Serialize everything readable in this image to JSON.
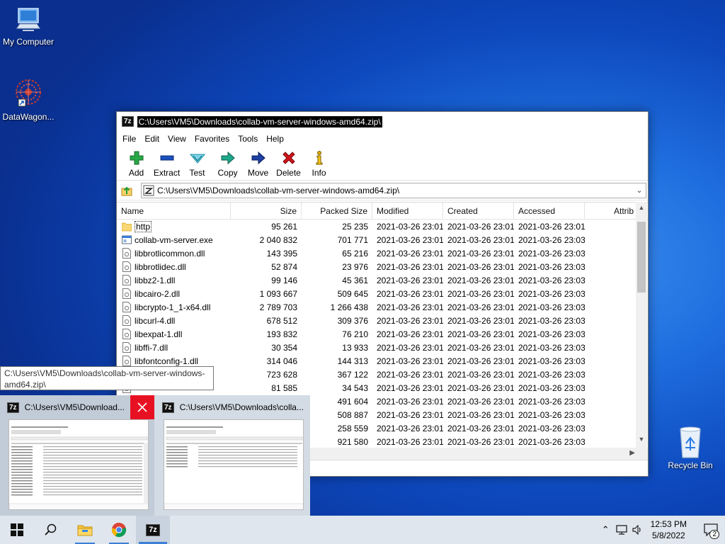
{
  "desktop": {
    "icons": [
      {
        "label": "My Computer",
        "icon": "computer-icon"
      },
      {
        "label": "DataWagon...",
        "icon": "datawagon-icon"
      },
      {
        "label": "Recycle Bin",
        "icon": "recycle-bin-icon"
      }
    ]
  },
  "window": {
    "title": "C:\\Users\\VM5\\Downloads\\collab-vm-server-windows-amd64.zip\\",
    "app_icon_text": "7z",
    "menu": [
      "File",
      "Edit",
      "View",
      "Favorites",
      "Tools",
      "Help"
    ],
    "toolbar": [
      {
        "label": "Add",
        "icon": "plus-icon",
        "color": "#28a745"
      },
      {
        "label": "Extract",
        "icon": "minus-icon",
        "color": "#1b4fbf"
      },
      {
        "label": "Test",
        "icon": "test-check-icon",
        "color": "#2ab3c9"
      },
      {
        "label": "Copy",
        "icon": "copy-arrow-icon",
        "color": "#1ba88a"
      },
      {
        "label": "Move",
        "icon": "move-arrow-icon",
        "color": "#1d3fa3"
      },
      {
        "label": "Delete",
        "icon": "delete-x-icon",
        "color": "#d0141b"
      },
      {
        "label": "Info",
        "icon": "info-icon",
        "color": "#e0a800"
      }
    ],
    "address": "C:\\Users\\VM5\\Downloads\\collab-vm-server-windows-amd64.zip\\",
    "columns": [
      "Name",
      "Size",
      "Packed Size",
      "Modified",
      "Created",
      "Accessed",
      "Attrib"
    ],
    "files": [
      {
        "name": "http",
        "type": "folder",
        "size": "95 261",
        "packed": "25 235",
        "modified": "2021-03-26 23:01",
        "created": "2021-03-26 23:01",
        "accessed": "2021-03-26 23:01"
      },
      {
        "name": "collab-vm-server.exe",
        "type": "exe",
        "size": "2 040 832",
        "packed": "701 771",
        "modified": "2021-03-26 23:01",
        "created": "2021-03-26 23:01",
        "accessed": "2021-03-26 23:03"
      },
      {
        "name": "libbrotlicommon.dll",
        "type": "dll",
        "size": "143 395",
        "packed": "65 216",
        "modified": "2021-03-26 23:01",
        "created": "2021-03-26 23:01",
        "accessed": "2021-03-26 23:03"
      },
      {
        "name": "libbrotlidec.dll",
        "type": "dll",
        "size": "52 874",
        "packed": "23 976",
        "modified": "2021-03-26 23:01",
        "created": "2021-03-26 23:01",
        "accessed": "2021-03-26 23:03"
      },
      {
        "name": "libbz2-1.dll",
        "type": "dll",
        "size": "99 146",
        "packed": "45 361",
        "modified": "2021-03-26 23:01",
        "created": "2021-03-26 23:01",
        "accessed": "2021-03-26 23:03"
      },
      {
        "name": "libcairo-2.dll",
        "type": "dll",
        "size": "1 093 667",
        "packed": "509 645",
        "modified": "2021-03-26 23:01",
        "created": "2021-03-26 23:01",
        "accessed": "2021-03-26 23:03"
      },
      {
        "name": "libcrypto-1_1-x64.dll",
        "type": "dll",
        "size": "2 789 703",
        "packed": "1 266 438",
        "modified": "2021-03-26 23:01",
        "created": "2021-03-26 23:01",
        "accessed": "2021-03-26 23:03"
      },
      {
        "name": "libcurl-4.dll",
        "type": "dll",
        "size": "678 512",
        "packed": "309 376",
        "modified": "2021-03-26 23:01",
        "created": "2021-03-26 23:01",
        "accessed": "2021-03-26 23:03"
      },
      {
        "name": "libexpat-1.dll",
        "type": "dll",
        "size": "193 832",
        "packed": "76 210",
        "modified": "2021-03-26 23:01",
        "created": "2021-03-26 23:01",
        "accessed": "2021-03-26 23:03"
      },
      {
        "name": "libffi-7.dll",
        "type": "dll",
        "size": "30 354",
        "packed": "13 933",
        "modified": "2021-03-26 23:01",
        "created": "2021-03-26 23:01",
        "accessed": "2021-03-26 23:03"
      },
      {
        "name": "libfontconfig-1.dll",
        "type": "dll",
        "size": "314 046",
        "packed": "144 313",
        "modified": "2021-03-26 23:01",
        "created": "2021-03-26 23:01",
        "accessed": "2021-03-26 23:03"
      },
      {
        "name": "",
        "type": "dll",
        "size": "723 628",
        "packed": "367 122",
        "modified": "2021-03-26 23:01",
        "created": "2021-03-26 23:01",
        "accessed": "2021-03-26 23:03"
      },
      {
        "name": "",
        "type": "dll",
        "size": "81 585",
        "packed": "34 543",
        "modified": "2021-03-26 23:01",
        "created": "2021-03-26 23:01",
        "accessed": "2021-03-26 23:03"
      },
      {
        "name": "",
        "type": "dll",
        "size": "",
        "packed": "491 604",
        "modified": "2021-03-26 23:01",
        "created": "2021-03-26 23:01",
        "accessed": "2021-03-26 23:03"
      },
      {
        "name": "",
        "type": "dll",
        "size": "",
        "packed": "508 887",
        "modified": "2021-03-26 23:01",
        "created": "2021-03-26 23:01",
        "accessed": "2021-03-26 23:03"
      },
      {
        "name": "",
        "type": "dll",
        "size": "",
        "packed": "258 559",
        "modified": "2021-03-26 23:01",
        "created": "2021-03-26 23:01",
        "accessed": "2021-03-26 23:03"
      },
      {
        "name": "",
        "type": "dll",
        "size": "",
        "packed": "921 580",
        "modified": "2021-03-26 23:01",
        "created": "2021-03-26 23:01",
        "accessed": "2021-03-26 23:03"
      }
    ]
  },
  "tooltip": {
    "line1": "C:\\Users\\VM5\\Downloads\\collab-vm-server-windows-",
    "line2": "amd64.zip\\"
  },
  "thumbnails": [
    {
      "title": "C:\\Users\\VM5\\Download...",
      "icon": "7z"
    },
    {
      "title": "C:\\Users\\VM5\\Downloads\\colla...",
      "icon": "7z"
    }
  ],
  "taskbar": {
    "time": "12:53 PM",
    "date": "5/8/2022",
    "notification_count": "2",
    "app_7z_label": "7z"
  }
}
